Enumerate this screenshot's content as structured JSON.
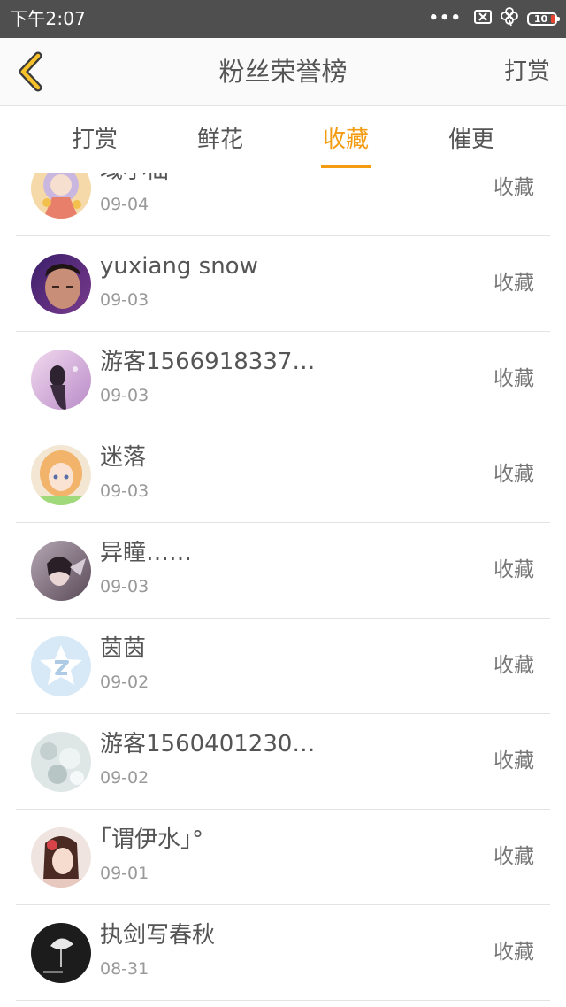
{
  "status_bar": {
    "time": "下午2:07",
    "dots": "•••",
    "battery_level": "10",
    "icons": [
      "sim-x-icon",
      "clover-icon",
      "battery-icon"
    ]
  },
  "header": {
    "back_icon": "chevron-left-icon",
    "title": "粉丝荣誉榜",
    "action": "打赏"
  },
  "tabs": [
    {
      "label": "打赏",
      "active": false
    },
    {
      "label": "鲜花",
      "active": false
    },
    {
      "label": "收藏",
      "active": true
    },
    {
      "label": "催更",
      "active": false
    }
  ],
  "list": {
    "items": [
      {
        "name": "域小仙",
        "date": "09-04",
        "action": "收藏"
      },
      {
        "name": "yuxiang snow",
        "date": "09-03",
        "action": "收藏"
      },
      {
        "name": "游客1566918337…",
        "date": "09-03",
        "action": "收藏"
      },
      {
        "name": "迷落",
        "date": "09-03",
        "action": "收藏"
      },
      {
        "name": "异瞳……",
        "date": "09-03",
        "action": "收藏"
      },
      {
        "name": "茵茵",
        "date": "09-02",
        "action": "收藏"
      },
      {
        "name": "游客1560401230…",
        "date": "09-02",
        "action": "收藏"
      },
      {
        "name": "｢谓伊水｣°",
        "date": "09-01",
        "action": "收藏"
      },
      {
        "name": "执剑写春秋",
        "date": "08-31",
        "action": "收藏"
      }
    ]
  },
  "colors": {
    "accent": "#f39c12",
    "status_bar": "#4f4f4f",
    "text": "#555555",
    "subtext": "#999999"
  }
}
